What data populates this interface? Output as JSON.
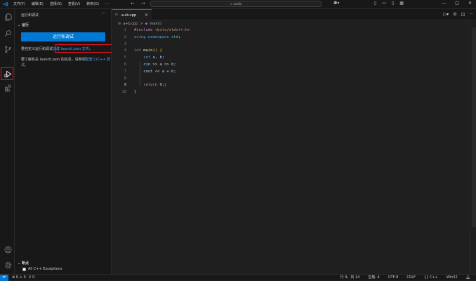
{
  "titlebar": {
    "menu": [
      "文件(F)",
      "编辑(E)",
      "选择(S)",
      "查看(V)",
      "转到(G)",
      "···"
    ],
    "back": "←",
    "forward": "→",
    "search": "code",
    "window_controls": [
      "—",
      "□",
      "✕"
    ]
  },
  "activity_icons": [
    "files-icon",
    "search-icon",
    "source-control-icon",
    "run-debug-icon",
    "extensions-icon",
    "account-icon",
    "settings-gear-icon"
  ],
  "sidebar": {
    "title": "运行和调试",
    "more": "···",
    "section": "运行",
    "run_button": "运行和调试",
    "line1_prefix": "要自定义运行和调试",
    "line1_link": "创建 launch.json 文件",
    "line1_suffix": "。",
    "line2_prefix": "要了解有关 launch.json 的信息，请参阅",
    "line2_link": "配置 C/C++ 调试",
    "line2_suffix": "。",
    "breakpoints_section": "断点",
    "breakpoint_item": "All C++ Exceptions"
  },
  "editor": {
    "tab_label": "a+b.cpp",
    "tab_icon": "G",
    "breadcrumb_file": "a+b.cpp",
    "breadcrumb_sep": ">",
    "breadcrumb_symbol": "main()",
    "line_numbers": [
      "1",
      "2",
      "3",
      "4",
      "5",
      "6",
      "7",
      "8",
      "9",
      "10"
    ],
    "active_line": "9"
  },
  "statusbar": {
    "remote": "⇌",
    "problems": "⊗ 0 ⚠ 0",
    "broadcast": "⚲ 0",
    "position": "行 9，列 14",
    "spaces": "空格: 4",
    "encoding": "UTF-8",
    "eol": "CRLF",
    "language": "C++",
    "platform": "Win32"
  },
  "colors": {
    "accent": "#0078d4",
    "highlight_box": "#e81123",
    "link": "#4daafc"
  }
}
